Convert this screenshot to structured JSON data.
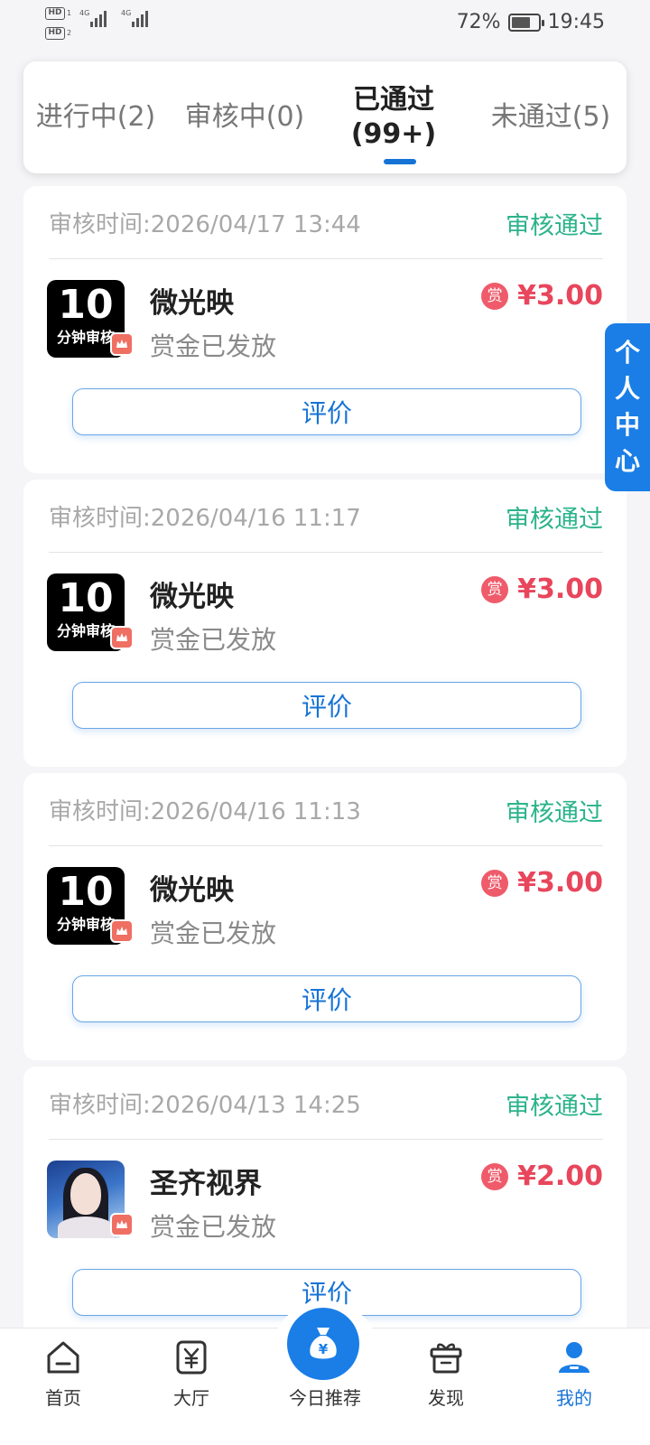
{
  "status_bar": {
    "hd1": "HD",
    "hd1_sub": "1",
    "hd2": "HD",
    "hd2_sub": "2",
    "net1": "4G",
    "net2": "4G",
    "battery_text": "72%",
    "battery_level": 0.72,
    "time": "19:45"
  },
  "tabs": [
    {
      "label": "进行中(2)",
      "active": false
    },
    {
      "label": "审核中(0)",
      "active": false
    },
    {
      "label_line1": "已通过",
      "label_line2": "(99+)",
      "active": true
    },
    {
      "label": "未通过(5)",
      "active": false
    }
  ],
  "side_tab": {
    "chars": [
      "个",
      "人",
      "中",
      "心"
    ]
  },
  "cards": [
    {
      "time": "审核时间:2026/04/17 13:44",
      "status": "审核通过",
      "name": "微光映",
      "reward_status": "赏金已发放",
      "price": "¥3.00",
      "reward_icon": "赏",
      "logo_num": "10",
      "logo_sub": "分钟审核",
      "button": "评价"
    },
    {
      "time": "审核时间:2026/04/16 11:17",
      "status": "审核通过",
      "name": "微光映",
      "reward_status": "赏金已发放",
      "price": "¥3.00",
      "reward_icon": "赏",
      "logo_num": "10",
      "logo_sub": "分钟审核",
      "button": "评价"
    },
    {
      "time": "审核时间:2026/04/16 11:13",
      "status": "审核通过",
      "name": "微光映",
      "reward_status": "赏金已发放",
      "price": "¥3.00",
      "reward_icon": "赏",
      "logo_num": "10",
      "logo_sub": "分钟审核",
      "button": "评价"
    },
    {
      "time": "审核时间:2026/04/13 14:25",
      "status": "审核通过",
      "name": "圣齐视界",
      "reward_status": "赏金已发放",
      "price": "¥2.00",
      "reward_icon": "赏",
      "button": "评价"
    }
  ],
  "bottom_nav": {
    "items": [
      {
        "label": "首页",
        "icon": "home-icon"
      },
      {
        "label": "大厅",
        "icon": "yen-ticket-icon"
      },
      {
        "label": "今日推荐",
        "icon": "money-bag-icon"
      },
      {
        "label": "发现",
        "icon": "gift-box-icon"
      },
      {
        "label": "我的",
        "icon": "user-icon",
        "active": true
      }
    ],
    "money_bag_glyph": "¥"
  },
  "colors": {
    "accent": "#1673d6",
    "status_green": "#2bb38a",
    "price_red": "#e8465c",
    "side_tab_blue": "#1a7ee6"
  }
}
